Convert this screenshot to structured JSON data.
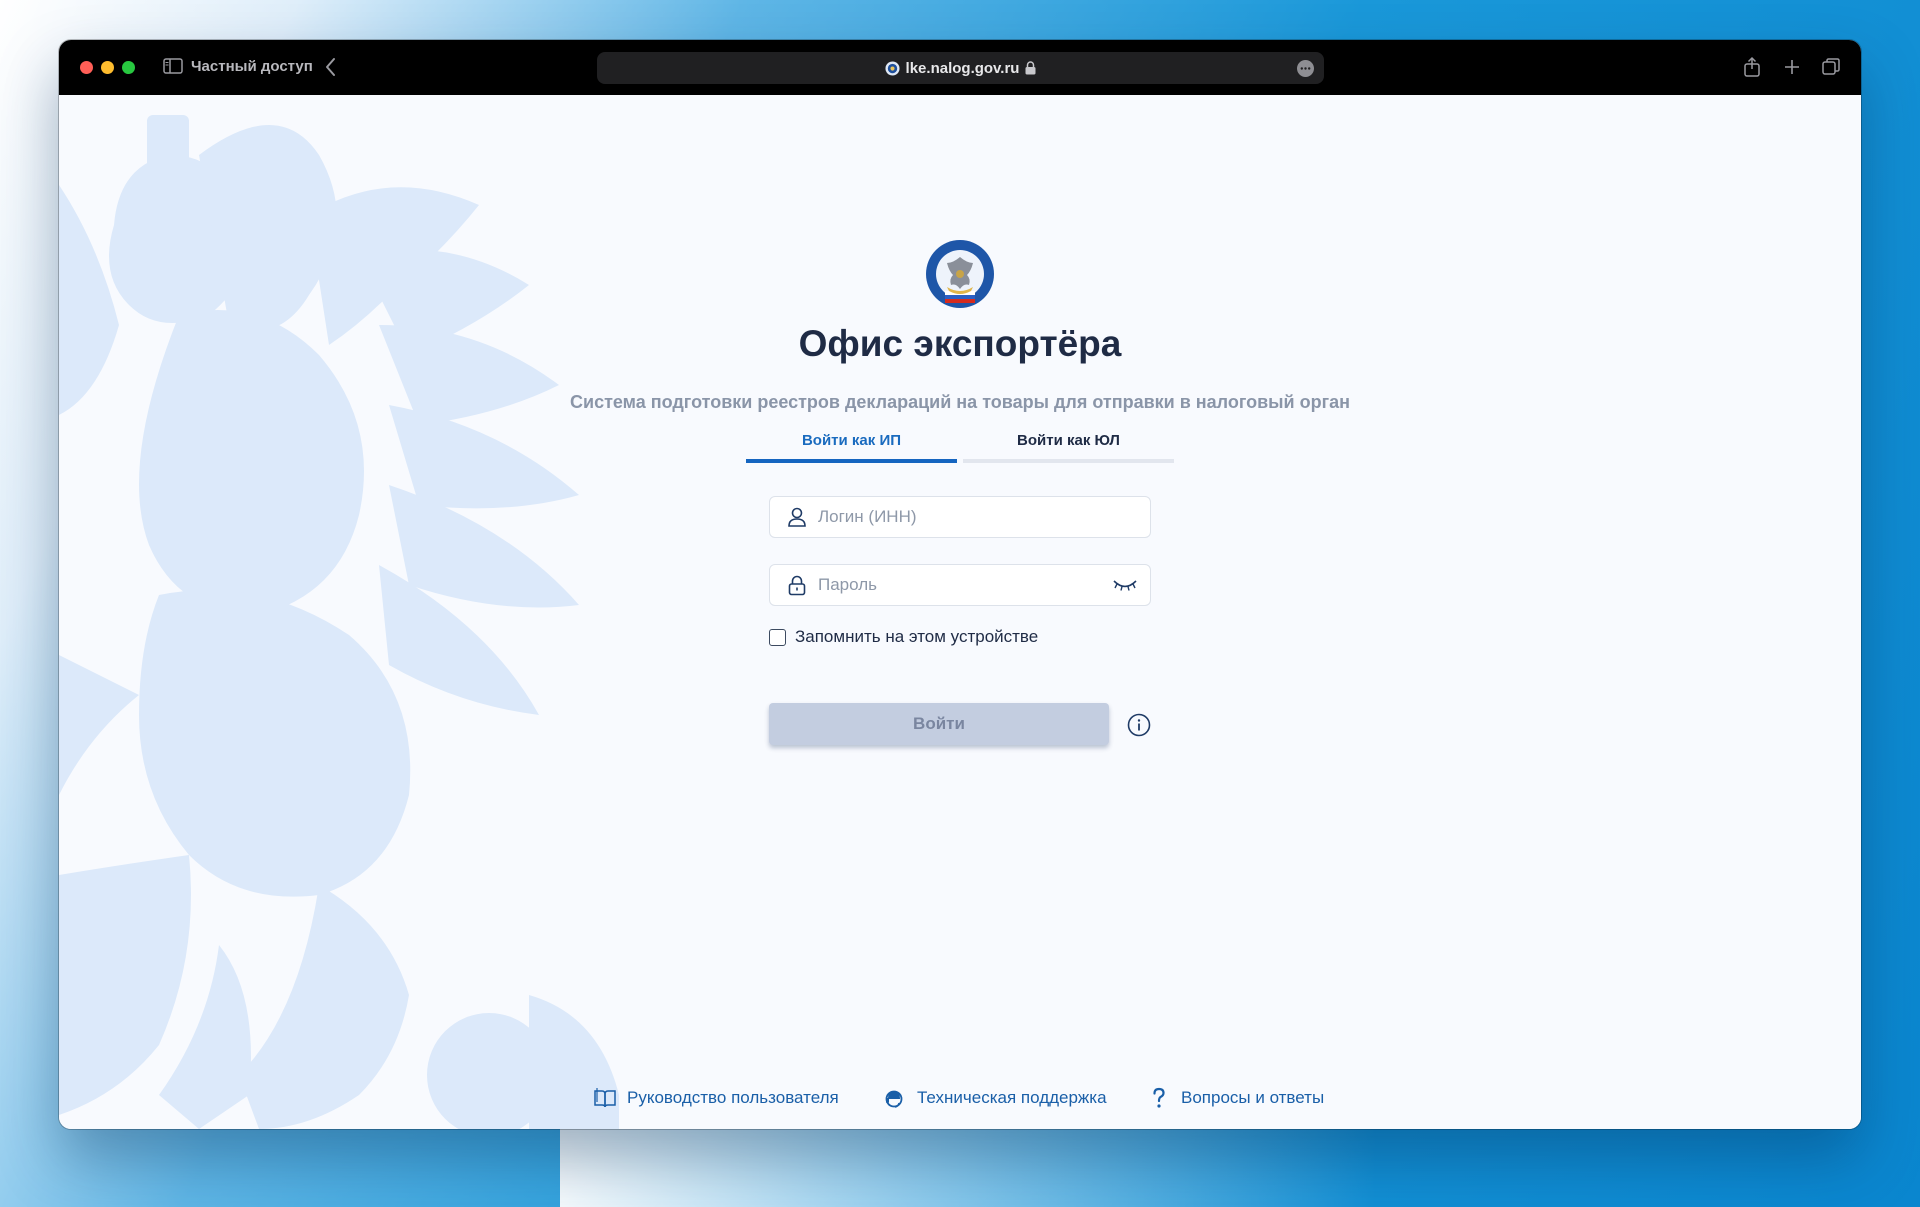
{
  "browser": {
    "private_label": "Частный доступ",
    "url": "lke.nalog.gov.ru"
  },
  "page": {
    "title": "Офис экспортёра",
    "subtitle": "Система подготовки реестров деклараций на товары для отправки в налоговый орган",
    "tabs": [
      {
        "label": "Войти как ИП",
        "active": true
      },
      {
        "label": "Войти как ЮЛ",
        "active": false
      }
    ],
    "form": {
      "login_placeholder": "Логин (ИНН)",
      "login_value": "",
      "password_placeholder": "Пароль",
      "password_value": "",
      "remember_label": "Запомнить на этом устройстве",
      "remember_checked": false,
      "submit_label": "Войти"
    },
    "footer": [
      {
        "label": "Руководство пользователя",
        "icon": "book-icon"
      },
      {
        "label": "Техническая поддержка",
        "icon": "support-icon"
      },
      {
        "label": "Вопросы и ответы",
        "icon": "question-icon"
      }
    ]
  },
  "colors": {
    "accent": "#1565c0",
    "title": "#1f2b45",
    "button_disabled": "#c3cde0",
    "link": "#1a5fa8"
  }
}
